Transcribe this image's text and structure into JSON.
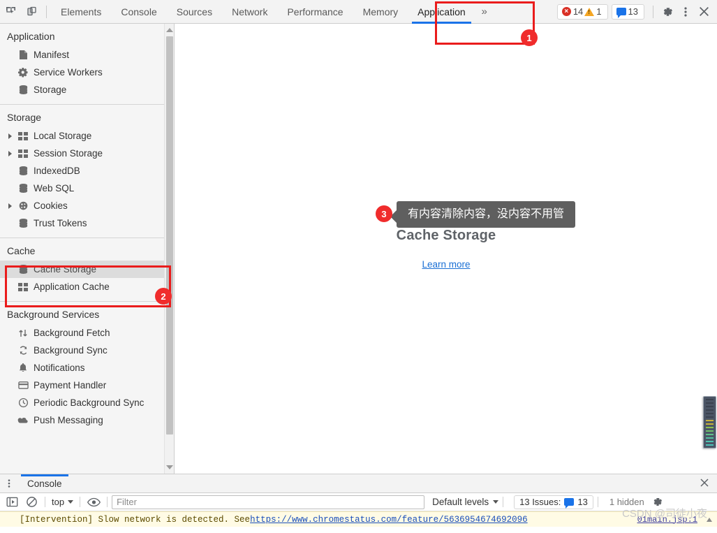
{
  "toolbar": {
    "inspect_icon": "inspect-cursor-icon",
    "device_icon": "device-toolbar-icon",
    "tabs": [
      {
        "label": "Elements",
        "active": false
      },
      {
        "label": "Console",
        "active": false
      },
      {
        "label": "Sources",
        "active": false
      },
      {
        "label": "Network",
        "active": false
      },
      {
        "label": "Performance",
        "active": false
      },
      {
        "label": "Memory",
        "active": false
      },
      {
        "label": "Application",
        "active": true
      }
    ],
    "more_tabs": "»",
    "errors_count": "14",
    "warnings_count": "1",
    "messages_count": "13",
    "settings_icon": "gear-icon",
    "more_icon": "kebab-menu-icon",
    "close_icon": "close-icon"
  },
  "sidebar": {
    "sections": [
      {
        "title": "Application",
        "items": [
          {
            "label": "Manifest",
            "icon": "document-icon",
            "expandable": false,
            "selected": false
          },
          {
            "label": "Service Workers",
            "icon": "gear-icon",
            "expandable": false,
            "selected": false
          },
          {
            "label": "Storage",
            "icon": "database-icon",
            "expandable": false,
            "selected": false
          }
        ]
      },
      {
        "title": "Storage",
        "items": [
          {
            "label": "Local Storage",
            "icon": "table-icon",
            "expandable": true,
            "selected": false
          },
          {
            "label": "Session Storage",
            "icon": "table-icon",
            "expandable": true,
            "selected": false
          },
          {
            "label": "IndexedDB",
            "icon": "database-icon",
            "expandable": false,
            "selected": false
          },
          {
            "label": "Web SQL",
            "icon": "database-icon",
            "expandable": false,
            "selected": false
          },
          {
            "label": "Cookies",
            "icon": "cookie-icon",
            "expandable": true,
            "selected": false
          },
          {
            "label": "Trust Tokens",
            "icon": "database-icon",
            "expandable": false,
            "selected": false
          }
        ]
      },
      {
        "title": "Cache",
        "items": [
          {
            "label": "Cache Storage",
            "icon": "database-icon",
            "expandable": false,
            "selected": true
          },
          {
            "label": "Application Cache",
            "icon": "table-icon",
            "expandable": false,
            "selected": false
          }
        ]
      },
      {
        "title": "Background Services",
        "items": [
          {
            "label": "Background Fetch",
            "icon": "updown-arrows-icon",
            "expandable": false,
            "selected": false
          },
          {
            "label": "Background Sync",
            "icon": "sync-icon",
            "expandable": false,
            "selected": false
          },
          {
            "label": "Notifications",
            "icon": "bell-icon",
            "expandable": false,
            "selected": false
          },
          {
            "label": "Payment Handler",
            "icon": "credit-card-icon",
            "expandable": false,
            "selected": false
          },
          {
            "label": "Periodic Background Sync",
            "icon": "clock-icon",
            "expandable": false,
            "selected": false
          },
          {
            "label": "Push Messaging",
            "icon": "cloud-icon",
            "expandable": false,
            "selected": false
          }
        ]
      }
    ]
  },
  "main": {
    "empty_title": "Cache Storage",
    "learn_more": "Learn more"
  },
  "annotations": {
    "step1": "1",
    "step2": "2",
    "step3": "3",
    "tooltip_text": "有内容清除内容，没内容不用管",
    "box_color": "#ea1c1c",
    "badge_color": "#f02c2c"
  },
  "console": {
    "drawer_tab": "Console",
    "kebab_icon": "kebab-menu-icon",
    "close_icon": "close-icon",
    "execute_icon": "execute-sidebar-icon",
    "clear_icon": "clear-console-icon",
    "context": "top",
    "eye_icon": "live-expression-icon",
    "filter_placeholder": "Filter",
    "filter_value": "",
    "levels": "Default levels",
    "issues_label": "13 Issues:",
    "issues_count": "13",
    "hidden_label": "1 hidden",
    "settings_icon": "gear-icon",
    "message_prefix": "[Intervention] Slow network is detected. See ",
    "message_link": "https://www.chromestatus.com/feature/5636954674692096",
    "message_source": "01main.jsp:1"
  },
  "watermark": "CSDN @司徒小夜"
}
